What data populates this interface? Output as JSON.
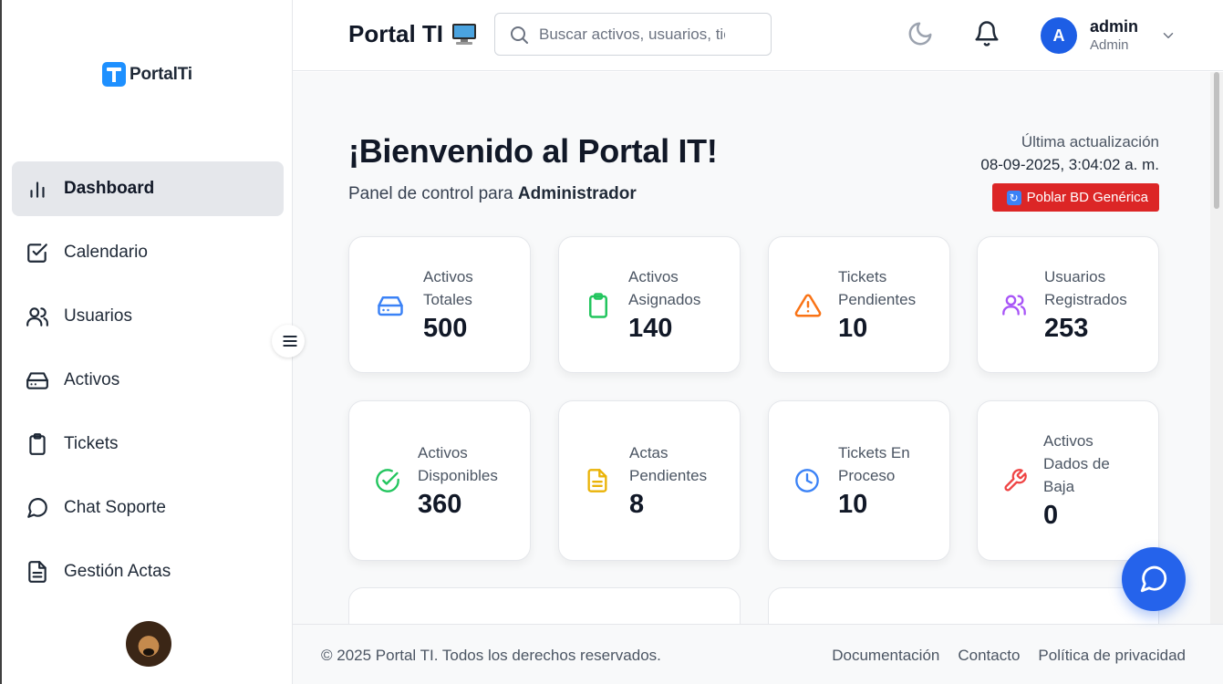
{
  "app": {
    "logo_text": "PortalTi",
    "header_title": "Portal TI"
  },
  "search": {
    "placeholder": "Buscar activos, usuarios, tickets..."
  },
  "user": {
    "initial": "A",
    "name": "admin",
    "role": "Admin"
  },
  "sidebar": {
    "items": [
      {
        "label": "Dashboard",
        "icon": "bar-chart-icon",
        "active": true
      },
      {
        "label": "Calendario",
        "icon": "checkbox-calendar-icon"
      },
      {
        "label": "Usuarios",
        "icon": "users-icon"
      },
      {
        "label": "Activos",
        "icon": "hard-drive-icon"
      },
      {
        "label": "Tickets",
        "icon": "clipboard-icon"
      },
      {
        "label": "Chat Soporte",
        "icon": "chat-bubble-icon"
      },
      {
        "label": "Gestión Actas",
        "icon": "document-icon"
      }
    ]
  },
  "welcome": {
    "title": "¡Bienvenido al Portal IT!",
    "subtitle_prefix": "Panel de control para",
    "subtitle_role": "Administrador",
    "last_update_label": "Última actualización",
    "last_update_value": "08-09-2025, 3:04:02 a. m.",
    "populate_button": "Poblar BD Genérica"
  },
  "stats": [
    {
      "label": "Activos Totales",
      "value": "500",
      "icon": "hard-drive-icon",
      "color": "#3b82f6"
    },
    {
      "label": "Activos Asignados",
      "value": "140",
      "icon": "clipboard-icon",
      "color": "#22c55e"
    },
    {
      "label": "Tickets Pendientes",
      "value": "10",
      "icon": "warning-triangle-icon",
      "color": "#f97316"
    },
    {
      "label": "Usuarios Registrados",
      "value": "253",
      "icon": "users-icon",
      "color": "#a855f7"
    },
    {
      "label": "Activos Disponibles",
      "value": "360",
      "icon": "check-circle-icon",
      "color": "#22c55e"
    },
    {
      "label": "Actas Pendientes",
      "value": "8",
      "icon": "document-icon",
      "color": "#eab308"
    },
    {
      "label": "Tickets En Proceso",
      "value": "10",
      "icon": "clock-icon",
      "color": "#3b82f6"
    },
    {
      "label": "Activos Dados de Baja",
      "value": "0",
      "icon": "wrench-icon",
      "color": "#ef4444"
    }
  ],
  "footer": {
    "copyright": "© 2025 Portal TI. Todos los derechos reservados.",
    "links": [
      "Documentación",
      "Contacto",
      "Política de privacidad"
    ]
  }
}
